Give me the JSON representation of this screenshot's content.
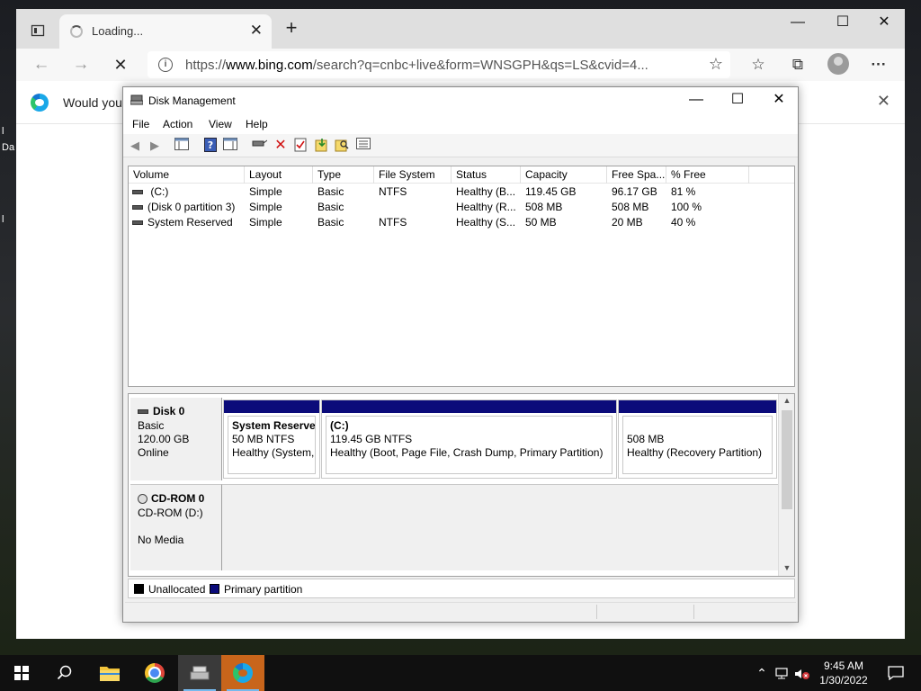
{
  "desktop": {
    "frag1": "l",
    "frag2": "Da",
    "frag3": "l"
  },
  "browser": {
    "tab_title": "Loading...",
    "tab_close": "✕",
    "new_tab": "+",
    "url_prefix": "https://",
    "url_host": "www.bing.com",
    "url_rest": "/search?q=cnbc+live&form=WNSGPH&qs=LS&cvid=4...",
    "info_icon": "i",
    "infobar_message": "Would you",
    "infobar_close": "✕",
    "icons": [
      "tab-actions-icon",
      "back-icon",
      "forward-icon",
      "stop-icon",
      "add-favorite-icon",
      "favorites-icon",
      "collections-icon",
      "profile-icon",
      "more-icon"
    ]
  },
  "disk_mgmt": {
    "title": "Disk Management",
    "menu": [
      "File",
      "Action",
      "View",
      "Help"
    ],
    "columns": [
      "Volume",
      "Layout",
      "Type",
      "File System",
      "Status",
      "Capacity",
      "Free Spa...",
      "% Free"
    ],
    "volumes": [
      {
        "volume": " (C:)",
        "layout": "Simple",
        "type": "Basic",
        "fs": "NTFS",
        "status": "Healthy (B...",
        "capacity": "119.45 GB",
        "free": "96.17 GB",
        "pct": "81 %"
      },
      {
        "volume": "(Disk 0 partition 3)",
        "layout": "Simple",
        "type": "Basic",
        "fs": "",
        "status": "Healthy (R...",
        "capacity": "508 MB",
        "free": "508 MB",
        "pct": "100 %"
      },
      {
        "volume": "System Reserved",
        "layout": "Simple",
        "type": "Basic",
        "fs": "NTFS",
        "status": "Healthy (S...",
        "capacity": "50 MB",
        "free": "20 MB",
        "pct": "40 %"
      }
    ],
    "disk0": {
      "name": "Disk 0",
      "kind": "Basic",
      "size": "120.00 GB",
      "state": "Online",
      "partitions": [
        {
          "title": "System Reserved",
          "line1": "50 MB NTFS",
          "line2": "Healthy (System, Active, Primary Partition)"
        },
        {
          "title": " (C:)",
          "line1": "119.45 GB NTFS",
          "line2": "Healthy (Boot, Page File, Crash Dump, Primary Partition)"
        },
        {
          "title": "",
          "line1": "508 MB",
          "line2": "Healthy (Recovery Partition)"
        }
      ]
    },
    "cdrom0": {
      "name": "CD-ROM 0",
      "drive": "CD-ROM (D:)",
      "media": "No Media"
    },
    "legend": [
      {
        "label": "Unallocated",
        "color": "#000000"
      },
      {
        "label": "Primary partition",
        "color": "#0b0b7a"
      }
    ]
  },
  "taskbar": {
    "time": "9:45 AM",
    "date": "1/30/2022",
    "apps": [
      "start-icon",
      "search-icon",
      "file-explorer-icon",
      "chrome-icon",
      "disk-management-icon",
      "edge-icon"
    ]
  }
}
